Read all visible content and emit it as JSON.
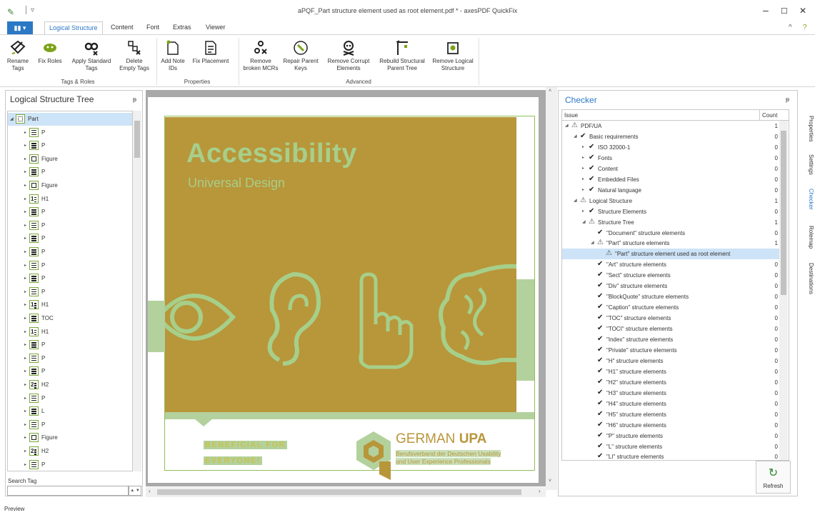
{
  "window": {
    "title": "aPQF_Part structure element used as root element.pdf * - axesPDF QuickFix",
    "minimize": "–",
    "maximize": "☐",
    "close": "✕"
  },
  "ribbon_tabs": {
    "file": "▮▮ ▾",
    "items": [
      "Logical Structure",
      "Content",
      "Font",
      "Extras",
      "Viewer"
    ],
    "active": "Logical Structure",
    "collapse": "^",
    "help": "?"
  },
  "ribbon": {
    "groups": [
      {
        "label": "Tags & Roles",
        "buttons": [
          "Rename Tags",
          "Fix Roles",
          "Apply Standard Tags",
          "Delete Empty Tags"
        ]
      },
      {
        "label": "Properties",
        "buttons": [
          "Add Note IDs",
          "Fix Placement"
        ]
      },
      {
        "label": "Advanced",
        "buttons": [
          "Remove broken MCRs",
          "Repair Parent Keys",
          "Remove Corrupt Elements",
          "Rebuild Structural Parent Tree",
          "Remove Logical Structure"
        ]
      }
    ]
  },
  "left_panel": {
    "title": "Logical Structure Tree",
    "pin": "ᵽ",
    "search_label": "Search Tag",
    "search_value": "",
    "spinner": "▲ ▼",
    "tree": [
      {
        "label": "Part",
        "icon": "part-icon",
        "root": true,
        "selected": true
      },
      {
        "label": "P",
        "icon": "paragraph-icon"
      },
      {
        "label": "P",
        "icon": "paragraph-icon"
      },
      {
        "label": "Figure",
        "icon": "figure-icon"
      },
      {
        "label": "P",
        "icon": "paragraph-icon"
      },
      {
        "label": "Figure",
        "icon": "figure-icon"
      },
      {
        "label": "H1",
        "icon": "h1-icon"
      },
      {
        "label": "P",
        "icon": "paragraph-icon"
      },
      {
        "label": "P",
        "icon": "paragraph-icon"
      },
      {
        "label": "P",
        "icon": "paragraph-icon"
      },
      {
        "label": "P",
        "icon": "paragraph-icon"
      },
      {
        "label": "P",
        "icon": "paragraph-icon"
      },
      {
        "label": "P",
        "icon": "paragraph-icon"
      },
      {
        "label": "P",
        "icon": "paragraph-icon"
      },
      {
        "label": "H1",
        "icon": "h1-icon"
      },
      {
        "label": "TOC",
        "icon": "toc-icon"
      },
      {
        "label": "H1",
        "icon": "h1-icon"
      },
      {
        "label": "P",
        "icon": "paragraph-icon"
      },
      {
        "label": "P",
        "icon": "paragraph-icon"
      },
      {
        "label": "P",
        "icon": "paragraph-icon"
      },
      {
        "label": "H2",
        "icon": "h2-icon"
      },
      {
        "label": "P",
        "icon": "paragraph-icon"
      },
      {
        "label": "L",
        "icon": "list-icon"
      },
      {
        "label": "P",
        "icon": "paragraph-icon"
      },
      {
        "label": "Figure",
        "icon": "figure-icon"
      },
      {
        "label": "H2",
        "icon": "h2-icon"
      },
      {
        "label": "P",
        "icon": "paragraph-icon"
      }
    ]
  },
  "document": {
    "headline": "Accessibility",
    "subheadline": "Universal Design",
    "tagline_1": "BENEFICIAL FOR",
    "tagline_2": "EVERYONE!",
    "org_name_light": "GERMAN",
    "org_name_bold": "UPA",
    "org_desc_1": "Berufsverband der Deutschen Usability",
    "org_desc_2": "und User Experience Professionals",
    "colors": {
      "hero": "#b8963a",
      "accent": "#a6cf8a",
      "border": "#8fbf5a"
    }
  },
  "checker": {
    "title": "Checker",
    "pin": "ᵽ",
    "col_issue": "Issue",
    "col_count": "Count",
    "refresh": "Refresh",
    "rows": [
      {
        "text": "PDF/UA",
        "count": "1",
        "status": "warn",
        "indent": 0,
        "exp": "◢"
      },
      {
        "text": "Basic requirements",
        "count": "0",
        "status": "ok",
        "indent": 1,
        "exp": "◢"
      },
      {
        "text": "ISO 32000-1",
        "count": "0",
        "status": "ok",
        "indent": 2,
        "exp": "▸"
      },
      {
        "text": "Fonts",
        "count": "0",
        "status": "ok",
        "indent": 2,
        "exp": "▸"
      },
      {
        "text": "Content",
        "count": "0",
        "status": "ok",
        "indent": 2,
        "exp": "▸"
      },
      {
        "text": "Embedded Files",
        "count": "0",
        "status": "ok",
        "indent": 2,
        "exp": "▸"
      },
      {
        "text": "Natural language",
        "count": "0",
        "status": "ok",
        "indent": 2,
        "exp": "▸"
      },
      {
        "text": "Logical Structure",
        "count": "1",
        "status": "warn",
        "indent": 1,
        "exp": "◢"
      },
      {
        "text": "Structure Elements",
        "count": "0",
        "status": "ok",
        "indent": 2,
        "exp": "▸"
      },
      {
        "text": "Structure Tree",
        "count": "1",
        "status": "warn",
        "indent": 2,
        "exp": "◢"
      },
      {
        "text": "\"Document\" structure elements",
        "count": "0",
        "status": "ok",
        "indent": 3,
        "exp": ""
      },
      {
        "text": "\"Part\" structure elements",
        "count": "1",
        "status": "warn",
        "indent": 3,
        "exp": "◢"
      },
      {
        "text": "\"Part\" structure element used as root element",
        "count": "",
        "status": "warn",
        "indent": 4,
        "exp": "",
        "selected": true
      },
      {
        "text": "\"Art\" structure elements",
        "count": "0",
        "status": "ok",
        "indent": 3,
        "exp": ""
      },
      {
        "text": "\"Sect\" structure elements",
        "count": "0",
        "status": "ok",
        "indent": 3,
        "exp": ""
      },
      {
        "text": "\"Div\" structure elements",
        "count": "0",
        "status": "ok",
        "indent": 3,
        "exp": ""
      },
      {
        "text": "\"BlockQuote\" structure elements",
        "count": "0",
        "status": "ok",
        "indent": 3,
        "exp": ""
      },
      {
        "text": "\"Caption\" structure elements",
        "count": "0",
        "status": "ok",
        "indent": 3,
        "exp": ""
      },
      {
        "text": "\"TOC\" structure elements",
        "count": "0",
        "status": "ok",
        "indent": 3,
        "exp": ""
      },
      {
        "text": "\"TOCI\" structure elements",
        "count": "0",
        "status": "ok",
        "indent": 3,
        "exp": ""
      },
      {
        "text": "\"Index\" structure elements",
        "count": "0",
        "status": "ok",
        "indent": 3,
        "exp": ""
      },
      {
        "text": "\"Private\" structure elements",
        "count": "0",
        "status": "ok",
        "indent": 3,
        "exp": ""
      },
      {
        "text": "\"H\" structure elements",
        "count": "0",
        "status": "ok",
        "indent": 3,
        "exp": ""
      },
      {
        "text": "\"H1\" structure elements",
        "count": "0",
        "status": "ok",
        "indent": 3,
        "exp": ""
      },
      {
        "text": "\"H2\" structure elements",
        "count": "0",
        "status": "ok",
        "indent": 3,
        "exp": ""
      },
      {
        "text": "\"H3\" structure elements",
        "count": "0",
        "status": "ok",
        "indent": 3,
        "exp": ""
      },
      {
        "text": "\"H4\" structure elements",
        "count": "0",
        "status": "ok",
        "indent": 3,
        "exp": ""
      },
      {
        "text": "\"H5\" structure elements",
        "count": "0",
        "status": "ok",
        "indent": 3,
        "exp": ""
      },
      {
        "text": "\"H6\" structure elements",
        "count": "0",
        "status": "ok",
        "indent": 3,
        "exp": ""
      },
      {
        "text": "\"P\" structure elements",
        "count": "0",
        "status": "ok",
        "indent": 3,
        "exp": ""
      },
      {
        "text": "\"L\" structure elements",
        "count": "0",
        "status": "ok",
        "indent": 3,
        "exp": ""
      },
      {
        "text": "\"LI\" structure elements",
        "count": "0",
        "status": "ok",
        "indent": 3,
        "exp": ""
      }
    ]
  },
  "side_tabs": [
    {
      "label": "Properties",
      "active": false
    },
    {
      "label": "Settings",
      "active": false
    },
    {
      "label": "Checker",
      "active": true
    },
    {
      "label": "Rolemap",
      "active": false
    },
    {
      "label": "Destinations",
      "active": false
    }
  ],
  "status": {
    "text": "Preview"
  }
}
